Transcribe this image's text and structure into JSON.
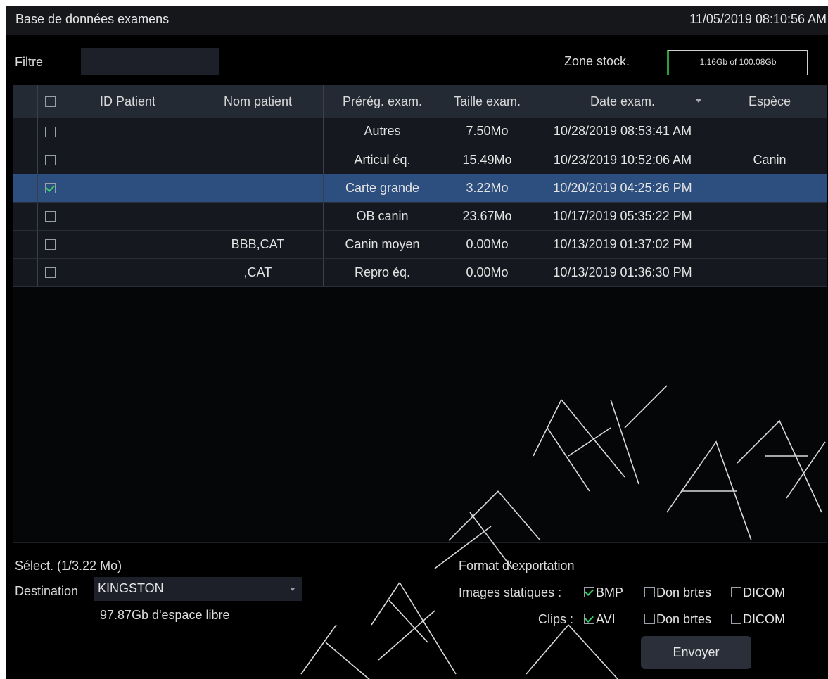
{
  "header": {
    "title": "Base de données examens",
    "datetime": "11/05/2019 08:10:56 AM"
  },
  "filter": {
    "label": "Filtre",
    "value": ""
  },
  "storage": {
    "label": "Zone stock.",
    "value": "1.16Gb of 100.08Gb"
  },
  "table": {
    "columns": [
      "ID Patient",
      "Nom patient",
      "Prérég. exam.",
      "Taille exam.",
      "Date exam.",
      "Espèce"
    ],
    "rows": [
      {
        "checked": false,
        "selected": false,
        "id": "",
        "name": "",
        "preset": "Autres",
        "size": "7.50Mo",
        "date": "10/28/2019 08:53:41 AM",
        "species": ""
      },
      {
        "checked": false,
        "selected": false,
        "id": "",
        "name": "",
        "preset": "Articul éq.",
        "size": "15.49Mo",
        "date": "10/23/2019 10:52:06 AM",
        "species": "Canin"
      },
      {
        "checked": true,
        "selected": true,
        "id": "",
        "name": "",
        "preset": "Carte grande",
        "size": "3.22Mo",
        "date": "10/20/2019 04:25:26 PM",
        "species": ""
      },
      {
        "checked": false,
        "selected": false,
        "id": "",
        "name": "",
        "preset": "OB canin",
        "size": "23.67Mo",
        "date": "10/17/2019 05:35:22 PM",
        "species": ""
      },
      {
        "checked": false,
        "selected": false,
        "id": "",
        "name": "BBB,CAT",
        "preset": "Canin moyen",
        "size": "0.00Mo",
        "date": "10/13/2019 01:37:02 PM",
        "species": ""
      },
      {
        "checked": false,
        "selected": false,
        "id": "",
        "name": ",CAT",
        "preset": "Repro éq.",
        "size": "0.00Mo",
        "date": "10/13/2019 01:36:30 PM",
        "species": ""
      }
    ]
  },
  "footer": {
    "selection": "Sélect. (1/3.22 Mo)",
    "destination_label": "Destination",
    "destination_value": "KINGSTON",
    "free_space": "97.87Gb d'espace libre",
    "export_title": "Format d'exportation",
    "static_label": "Images statiques :",
    "clips_label": "Clips :",
    "static_options": [
      {
        "label": "BMP",
        "checked": true
      },
      {
        "label": "Don brtes",
        "checked": false
      },
      {
        "label": "DICOM",
        "checked": false
      }
    ],
    "clip_options": [
      {
        "label": "AVI",
        "checked": true
      },
      {
        "label": "Don brtes",
        "checked": false
      },
      {
        "label": "DICOM",
        "checked": false
      }
    ],
    "send_label": "Envoyer"
  },
  "colors": {
    "selected_row": "#2d4f7f",
    "check_mark": "#3ad06a",
    "storage_accent": "#2e9e3a"
  }
}
